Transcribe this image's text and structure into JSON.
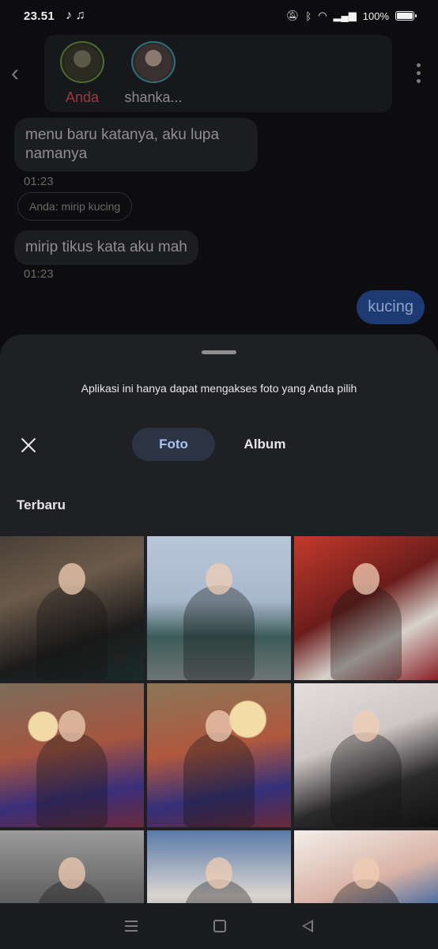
{
  "status_bar": {
    "time": "23.51",
    "notification_icons": "♪ ♫",
    "battery": "100%"
  },
  "chat": {
    "participants": [
      {
        "name": "Anda"
      },
      {
        "name": "shanka..."
      }
    ],
    "messages": [
      {
        "text": "menu baru katanya, aku lupa namanya",
        "time": "01:23"
      },
      {
        "reply_preview": "Anda: mirip kucing"
      },
      {
        "text": "mirip tikus kata aku mah",
        "time": "01:23"
      },
      {
        "text": "kucing",
        "sent": true
      }
    ]
  },
  "picker": {
    "notice": "Aplikasi ini hanya dapat mengakses foto yang Anda pilih",
    "tabs": [
      {
        "label": "Foto",
        "selected": true
      },
      {
        "label": "Album",
        "selected": false
      }
    ],
    "section_title": "Terbaru",
    "photos": [
      "photo-1",
      "photo-2",
      "photo-3",
      "photo-4",
      "photo-5",
      "photo-6",
      "photo-7",
      "photo-8",
      "photo-9"
    ]
  },
  "nav_bar": {
    "icons": [
      "menu-icon",
      "home-icon",
      "back-icon"
    ]
  },
  "colors": {
    "accent_tab": "#a9c2f2",
    "sent_bubble": "#1d3a72",
    "self_name": "#9a3a44"
  }
}
